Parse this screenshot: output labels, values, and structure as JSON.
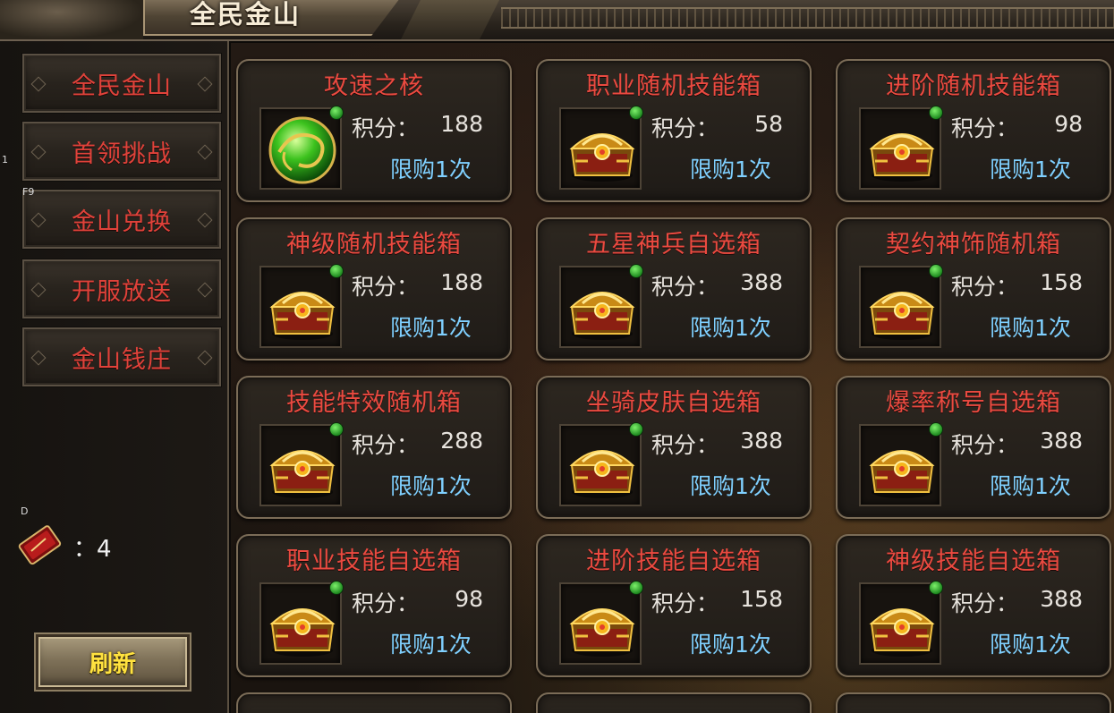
{
  "window": {
    "title": "全民金山"
  },
  "sidebar": {
    "items": [
      {
        "label": "全民金山"
      },
      {
        "label": "首领挑战"
      },
      {
        "label": "金山兑换"
      },
      {
        "label": "开服放送"
      },
      {
        "label": "金山钱庄"
      }
    ],
    "hotkeys": {
      "f9": "F9",
      "d": "D",
      "one": "1"
    },
    "ticket": {
      "icon": "red-ticket-icon",
      "count": "：4"
    },
    "refresh_label": "刷新"
  },
  "shop": {
    "score_label": "积分：",
    "items": [
      {
        "name": "攻速之核",
        "icon": "green-orb-icon",
        "score": "188",
        "limit": "限购1次"
      },
      {
        "name": "职业随机技能箱",
        "icon": "treasure-chest-icon",
        "score": "58",
        "limit": "限购1次"
      },
      {
        "name": "进阶随机技能箱",
        "icon": "treasure-chest-icon",
        "score": "98",
        "limit": "限购1次"
      },
      {
        "name": "神级随机技能箱",
        "icon": "treasure-chest-icon",
        "score": "188",
        "limit": "限购1次"
      },
      {
        "name": "五星神兵自选箱",
        "icon": "treasure-chest-icon",
        "score": "388",
        "limit": "限购1次"
      },
      {
        "name": "契约神饰随机箱",
        "icon": "treasure-chest-icon",
        "score": "158",
        "limit": "限购1次"
      },
      {
        "name": "技能特效随机箱",
        "icon": "treasure-chest-icon",
        "score": "288",
        "limit": "限购1次"
      },
      {
        "name": "坐骑皮肤自选箱",
        "icon": "treasure-chest-icon",
        "score": "388",
        "limit": "限购1次"
      },
      {
        "name": "爆率称号自选箱",
        "icon": "treasure-chest-icon",
        "score": "388",
        "limit": "限购1次"
      },
      {
        "name": "职业技能自选箱",
        "icon": "treasure-chest-icon",
        "score": "98",
        "limit": "限购1次"
      },
      {
        "name": "进阶技能自选箱",
        "icon": "treasure-chest-icon",
        "score": "158",
        "limit": "限购1次"
      },
      {
        "name": "神级技能自选箱",
        "icon": "treasure-chest-icon",
        "score": "388",
        "limit": "限购1次"
      }
    ]
  },
  "colors": {
    "item_name": "#ea4a40",
    "limit_text": "#7fd0ff",
    "refresh_text": "#ffe23f",
    "status_dot": "#4ccc40"
  }
}
